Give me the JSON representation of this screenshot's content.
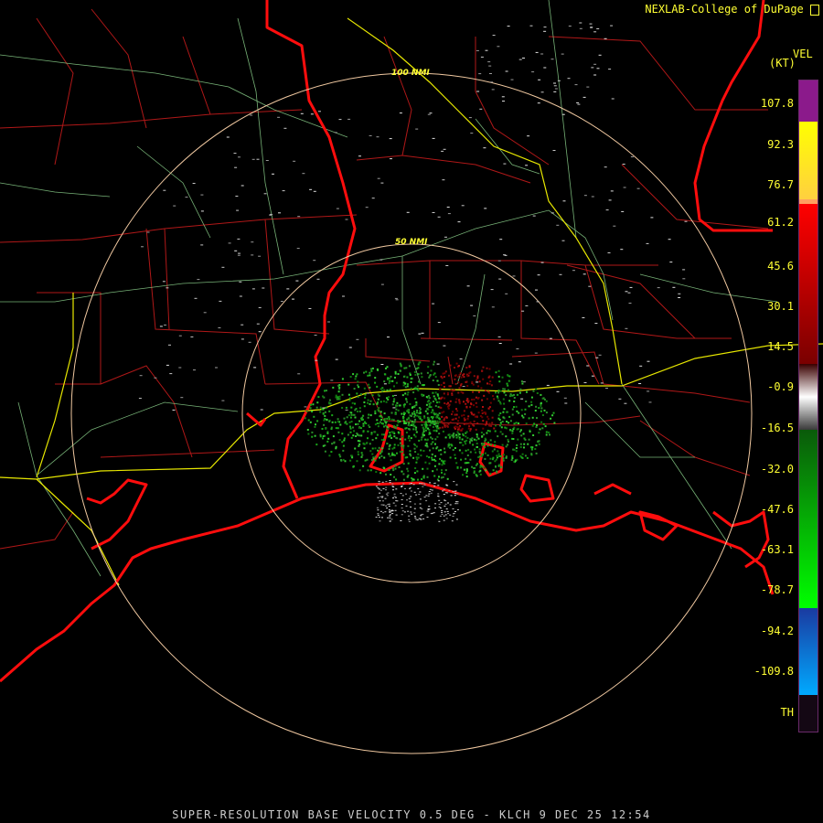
{
  "credit": "NEXLAB-College of DuPage",
  "legend": {
    "title": "VEL",
    "units": "(KT)",
    "ticks": [
      "107.8",
      "92.3",
      "76.7",
      "61.2",
      "45.6",
      "30.1",
      "14.5",
      "-0.9",
      "-16.5",
      "-32.0",
      "-47.6",
      "-63.1",
      "-78.7",
      "-94.2",
      "-109.8",
      "TH"
    ],
    "colors": {
      "purple": "#8b1a8b",
      "yellow": "#ffff00",
      "orange": "#ffa060",
      "red": "#ff0000",
      "darkred": "#7a0000",
      "gray": "#aaaaaa",
      "darkgreen": "#0a5a0a",
      "green": "#00e000",
      "blue": "#1e5adc",
      "cyan": "#00aaff",
      "th": "#1a0a1a"
    }
  },
  "rings": [
    "100 NMI",
    "50 NMI"
  ],
  "footer": "SUPER-RESOLUTION BASE VELOCITY 0.5 DEG - KLCH 9 DEC 25 12:54"
}
